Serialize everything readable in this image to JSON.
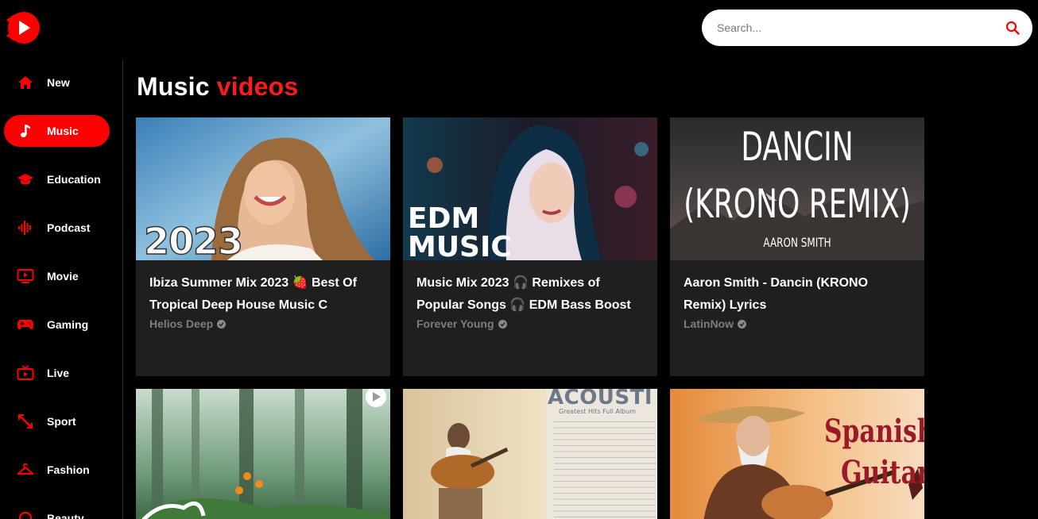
{
  "search": {
    "placeholder": "Search..."
  },
  "sidebar": {
    "items": [
      {
        "label": "New",
        "icon": "home-icon",
        "active": false
      },
      {
        "label": "Music",
        "icon": "music-note-icon",
        "active": true
      },
      {
        "label": "Education",
        "icon": "graduation-cap-icon",
        "active": false
      },
      {
        "label": "Podcast",
        "icon": "sound-wave-icon",
        "active": false
      },
      {
        "label": "Movie",
        "icon": "tv-play-icon",
        "active": false
      },
      {
        "label": "Gaming",
        "icon": "gamepad-icon",
        "active": false
      },
      {
        "label": "Live",
        "icon": "live-tv-icon",
        "active": false
      },
      {
        "label": "Sport",
        "icon": "sport-icon",
        "active": false
      },
      {
        "label": "Fashion",
        "icon": "hanger-icon",
        "active": false
      },
      {
        "label": "Beauty",
        "icon": "beauty-icon",
        "active": false
      }
    ]
  },
  "page": {
    "title_main": "Music",
    "title_accent": "videos"
  },
  "videos": [
    {
      "title": "Ibiza Summer Mix 2023 🍓 Best Of Tropical Deep House Music C",
      "channel": "Helios Deep",
      "thumb_text": "2023"
    },
    {
      "title": "Music Mix 2023 🎧 Remixes of Popular Songs 🎧 EDM Bass Boost",
      "channel": "Forever Young",
      "thumb_text": "EDM MUSIC"
    },
    {
      "title": "Aaron Smith - Dancin (KRONO Remix) Lyrics",
      "channel": "LatinNow",
      "thumb_text_1": "DANCIN",
      "thumb_text_2": "(KRONO REMIX)",
      "thumb_text_3": "AARON SMITH"
    },
    {
      "title": "",
      "channel": ""
    },
    {
      "title": "",
      "channel": "",
      "thumb_text": "ACOUSTI",
      "thumb_subtext": "Greatest Hits Full Album"
    },
    {
      "title": "",
      "channel": "",
      "thumb_text_1": "Spanish",
      "thumb_text_2": "Guitar"
    }
  ],
  "colors": {
    "accent": "#ff0000",
    "card_bg": "#1f1f1f",
    "muted": "#7d7d7d"
  }
}
